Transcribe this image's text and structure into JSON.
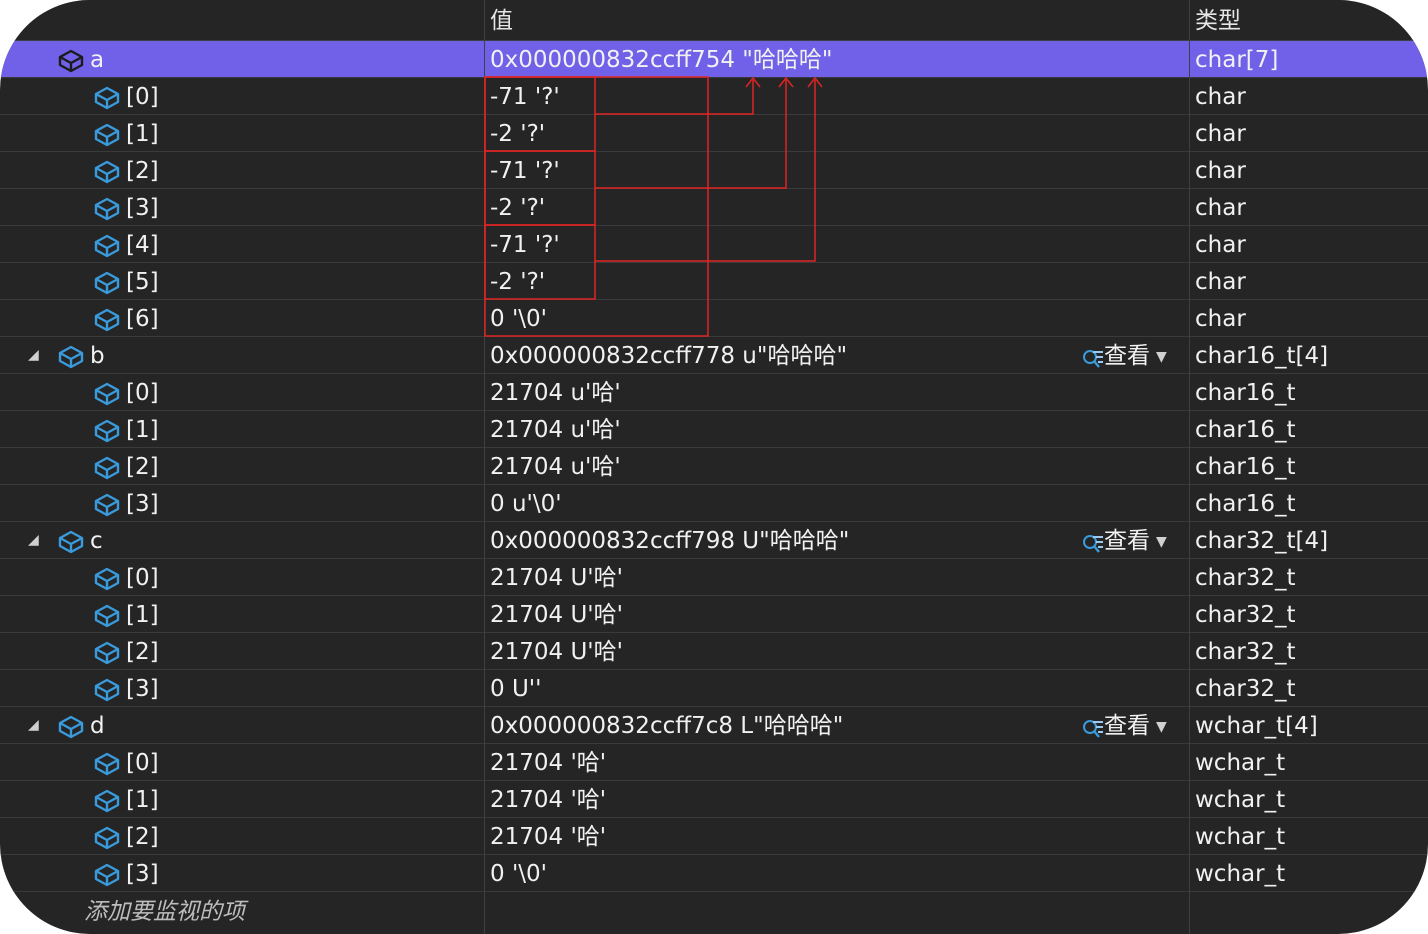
{
  "header": {
    "col_name": "",
    "col_value": "值",
    "col_type": "类型"
  },
  "view_label": "查看",
  "footer": {
    "add_watch_text": "添加要监视的项"
  },
  "rows": [
    {
      "name": "a",
      "value": "0x000000832ccff754 \"哈哈哈\"",
      "type": "char[7]",
      "level": 0,
      "expand": "open",
      "selected": true,
      "view": false
    },
    {
      "name": "[0]",
      "value": "-71 '?'",
      "type": "char",
      "level": 1
    },
    {
      "name": "[1]",
      "value": "-2 '?'",
      "type": "char",
      "level": 1
    },
    {
      "name": "[2]",
      "value": "-71 '?'",
      "type": "char",
      "level": 1
    },
    {
      "name": "[3]",
      "value": "-2 '?'",
      "type": "char",
      "level": 1
    },
    {
      "name": "[4]",
      "value": "-71 '?'",
      "type": "char",
      "level": 1
    },
    {
      "name": "[5]",
      "value": "-2 '?'",
      "type": "char",
      "level": 1
    },
    {
      "name": "[6]",
      "value": "0 '\\0'",
      "type": "char",
      "level": 1
    },
    {
      "name": "b",
      "value": "0x000000832ccff778 u\"哈哈哈\"",
      "type": "char16_t[4]",
      "level": 0,
      "expand": "open",
      "view": true
    },
    {
      "name": "[0]",
      "value": "21704 u'哈'",
      "type": "char16_t",
      "level": 1
    },
    {
      "name": "[1]",
      "value": "21704 u'哈'",
      "type": "char16_t",
      "level": 1
    },
    {
      "name": "[2]",
      "value": "21704 u'哈'",
      "type": "char16_t",
      "level": 1
    },
    {
      "name": "[3]",
      "value": "0 u'\\0'",
      "type": "char16_t",
      "level": 1
    },
    {
      "name": "c",
      "value": "0x000000832ccff798 U\"哈哈哈\"",
      "type": "char32_t[4]",
      "level": 0,
      "expand": "open",
      "view": true
    },
    {
      "name": "[0]",
      "value": "21704 U'哈'",
      "type": "char32_t",
      "level": 1
    },
    {
      "name": "[1]",
      "value": "21704 U'哈'",
      "type": "char32_t",
      "level": 1
    },
    {
      "name": "[2]",
      "value": "21704 U'哈'",
      "type": "char32_t",
      "level": 1
    },
    {
      "name": "[3]",
      "value": "0 U''",
      "type": "char32_t",
      "level": 1
    },
    {
      "name": "d",
      "value": "0x000000832ccff7c8 L\"哈哈哈\"",
      "type": "wchar_t[4]",
      "level": 0,
      "expand": "open",
      "view": true
    },
    {
      "name": "[0]",
      "value": "21704 '哈'",
      "type": "wchar_t",
      "level": 1
    },
    {
      "name": "[1]",
      "value": "21704 '哈'",
      "type": "wchar_t",
      "level": 1
    },
    {
      "name": "[2]",
      "value": "21704 '哈'",
      "type": "wchar_t",
      "level": 1
    },
    {
      "name": "[3]",
      "value": "0 '\\0'",
      "type": "wchar_t",
      "level": 1
    }
  ],
  "colors": {
    "panel_bg": "#252526",
    "selection": "#7160e8",
    "annotation_red": "#e02424",
    "icon_blue": "#3a9bdc",
    "text": "#f1f1f1"
  }
}
